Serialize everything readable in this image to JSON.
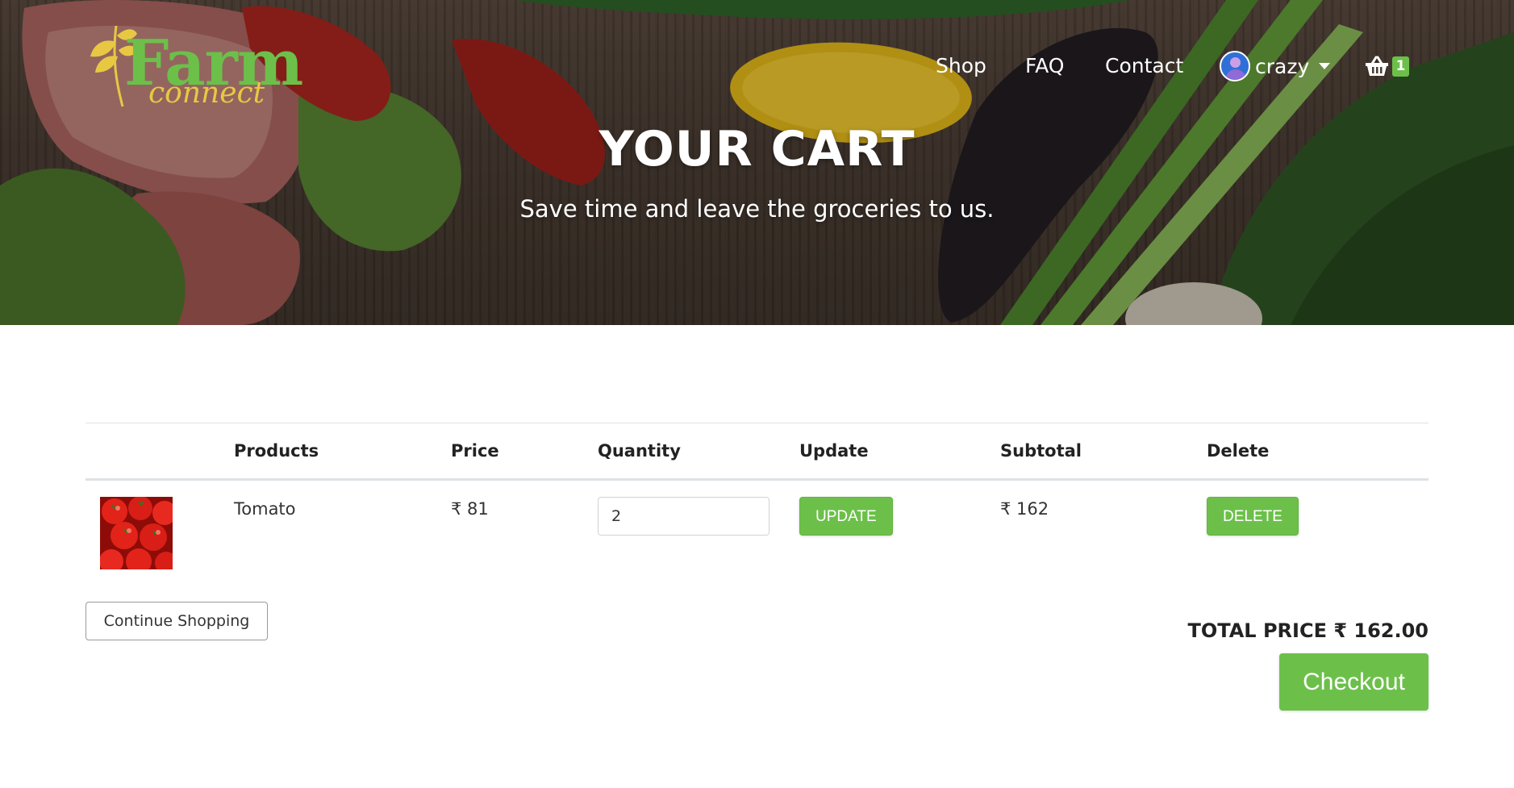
{
  "brand": {
    "name_main": "Farm",
    "name_sub": "connect",
    "accent_color": "#6cc04a",
    "secondary_color": "#e8c843"
  },
  "nav": {
    "links": [
      "Shop",
      "FAQ",
      "Contact"
    ],
    "user": {
      "name": "crazy",
      "avatar_icon": "user-avatar-icon",
      "dropdown_icon": "caret-down-icon"
    },
    "cart": {
      "icon": "shopping-basket-icon",
      "count": "1"
    }
  },
  "hero": {
    "title": "YOUR CART",
    "subtitle": "Save time and leave the groceries to us."
  },
  "cart_table": {
    "headers": [
      "",
      "Products",
      "Price",
      "Quantity",
      "Update",
      "Subtotal",
      "Delete"
    ],
    "rows": [
      {
        "image_icon": "tomato-image",
        "product": "Tomato",
        "price": "₹ 81",
        "quantity": "2",
        "update_label": "UPDATE",
        "subtotal": "₹ 162",
        "delete_label": "DELETE"
      }
    ]
  },
  "actions": {
    "continue_label": "Continue Shopping",
    "total_label": "TOTAL PRICE ₹ 162.00",
    "checkout_label": "Checkout"
  }
}
